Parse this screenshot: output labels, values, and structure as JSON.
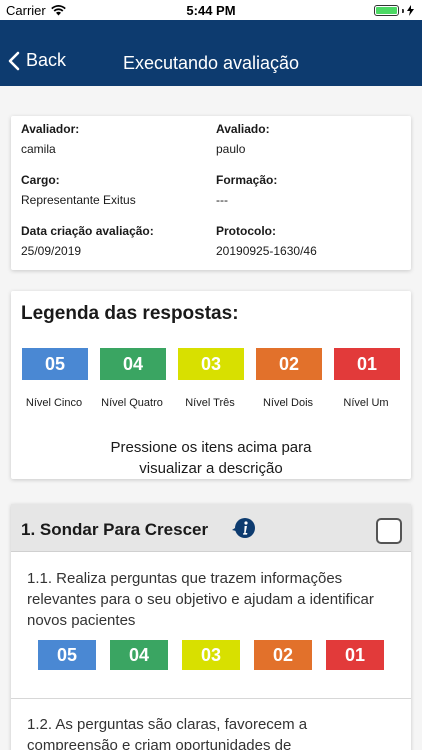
{
  "status_bar": {
    "carrier": "Carrier",
    "time": "5:44 PM"
  },
  "nav": {
    "back_label": "Back",
    "title": "Executando avaliação"
  },
  "info": {
    "avaliador_label": "Avaliador:",
    "avaliador_value": "camila",
    "avaliado_label": "Avaliado:",
    "avaliado_value": "paulo",
    "cargo_label": "Cargo:",
    "cargo_value": "Representante Exitus",
    "formacao_label": "Formação:",
    "formacao_value": "---",
    "data_label": "Data criação avaliação:",
    "data_value": "25/09/2019",
    "protocolo_label": "Protocolo:",
    "protocolo_value": "20190925-1630/46"
  },
  "legend": {
    "title": "Legenda das respostas:",
    "levels": [
      {
        "value": "05",
        "label": "Nível Cinco",
        "color": "#4a88d3"
      },
      {
        "value": "04",
        "label": "Nível Quatro",
        "color": "#3aa562"
      },
      {
        "value": "03",
        "label": "Nível Três",
        "color": "#d8e000"
      },
      {
        "value": "02",
        "label": "Nível Dois",
        "color": "#e2712b"
      },
      {
        "value": "01",
        "label": "Nível Um",
        "color": "#e23a3a"
      }
    ],
    "hint_line1": "Pressione os itens acima para",
    "hint_line2": "visualizar a descrição"
  },
  "section": {
    "title": "1. Sondar Para Crescer",
    "questions": [
      {
        "text": "1.1. Realiza perguntas que trazem informações relevantes para o seu objetivo e ajudam a identificar novos pacientes"
      },
      {
        "text": "1.2. As perguntas são claras, favorecem a compreensão e criam oportunidades de"
      }
    ]
  }
}
